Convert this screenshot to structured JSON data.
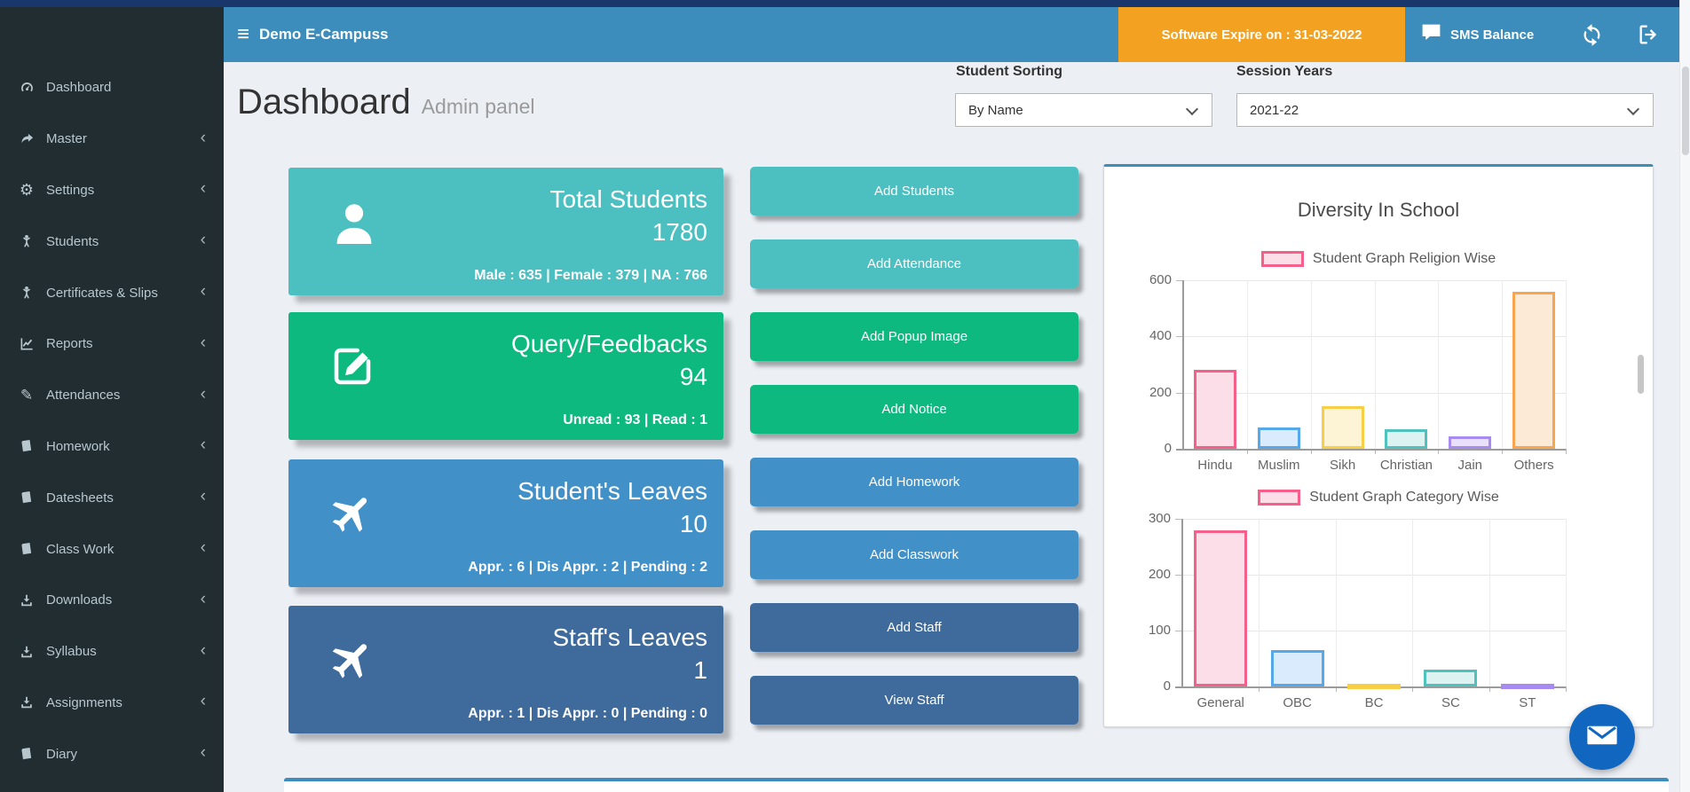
{
  "page": {
    "background": "#ecf0f5",
    "accent": "#3c8dbc"
  },
  "navbar": {
    "color": "#3c8dbc",
    "top_strip_color": "#1a376b",
    "title": "Demo E-Campuss",
    "expire_badge": {
      "text": "Software Expire on : 31-03-2022",
      "color": "#f3a120"
    },
    "sms_balance": {
      "icon": "comment-icon",
      "label": "SMS Balance"
    },
    "refresh_icon": "refresh-icon",
    "logout_icon": "logout-icon"
  },
  "sidebar": {
    "background": "#222d32",
    "text_color": "#b8c7ce",
    "items": [
      {
        "label": "Dashboard",
        "icon": "dashboard-icon",
        "chevron": false
      },
      {
        "label": "Master",
        "icon": "forward-arrow-icon",
        "chevron": true
      },
      {
        "label": "Settings",
        "icon": "gear-icon",
        "chevron": true
      },
      {
        "label": "Students",
        "icon": "child-icon",
        "chevron": true
      },
      {
        "label": "Certificates & Slips",
        "icon": "child-icon",
        "chevron": true
      },
      {
        "label": "Reports",
        "icon": "line-chart-icon",
        "chevron": true
      },
      {
        "label": "Attendances",
        "icon": "pencil-icon",
        "chevron": true
      },
      {
        "label": "Homework",
        "icon": "book-icon",
        "chevron": true
      },
      {
        "label": "Datesheets",
        "icon": "book-icon",
        "chevron": true
      },
      {
        "label": "Class Work",
        "icon": "book-icon",
        "chevron": true
      },
      {
        "label": "Downloads",
        "icon": "download-icon",
        "chevron": true
      },
      {
        "label": "Syllabus",
        "icon": "download-icon",
        "chevron": true
      },
      {
        "label": "Assignments",
        "icon": "download-icon",
        "chevron": true
      },
      {
        "label": "Diary",
        "icon": "book-icon",
        "chevron": true
      }
    ]
  },
  "header": {
    "title": "Dashboard",
    "subtitle": "Admin panel",
    "student_sorting": {
      "label": "Student Sorting",
      "value": "By Name"
    },
    "session_years": {
      "label": "Session Years",
      "value": "2021-22"
    }
  },
  "cards": [
    {
      "title": "Total Students",
      "value": "1780",
      "stats": "Male : 635 | Female : 379 | NA : 766",
      "color": "#4cbfc0",
      "icon": "user-icon"
    },
    {
      "title": "Query/Feedbacks",
      "value": "94",
      "stats": "Unread : 93 | Read : 1",
      "color": "#0db97e",
      "icon": "edit-icon"
    },
    {
      "title": "Student's Leaves",
      "value": "10",
      "stats": "Appr. : 6 | Dis Appr. : 2 | Pending : 2",
      "color": "#4290c8",
      "icon": "plane-icon"
    },
    {
      "title": "Staff's Leaves",
      "value": "1",
      "stats": "Appr. : 1 | Dis Appr. : 0 | Pending : 0",
      "color": "#3e6b9c",
      "icon": "plane-icon"
    }
  ],
  "actions": [
    {
      "label": "Add Students",
      "color": "#4cbfc0"
    },
    {
      "label": "Add Attendance",
      "color": "#4cbfc0"
    },
    {
      "label": "Add Popup Image",
      "color": "#0db97e"
    },
    {
      "label": "Add Notice",
      "color": "#0db97e"
    },
    {
      "label": "Add Homework",
      "color": "#4290c8"
    },
    {
      "label": "Add Classwork",
      "color": "#4290c8"
    },
    {
      "label": "Add Staff",
      "color": "#3e6b9c"
    },
    {
      "label": "View Staff",
      "color": "#3e6b9c"
    }
  ],
  "chart_data": [
    {
      "type": "bar",
      "title": "Diversity In School",
      "legend": "Student Graph Religion Wise",
      "categories": [
        "Hindu",
        "Muslim",
        "Sikh",
        "Christian",
        "Jain",
        "Others"
      ],
      "values": [
        280,
        75,
        150,
        70,
        45,
        560
      ],
      "ylim": [
        0,
        600
      ],
      "yticks": [
        600,
        400,
        200,
        0
      ],
      "grid": true,
      "legend_position": "top",
      "colors": [
        {
          "border": "#f4608a",
          "fill": "#fbdee8"
        },
        {
          "border": "#55a8ea",
          "fill": "#d9ebfc"
        },
        {
          "border": "#f7ce45",
          "fill": "#fdf4d5"
        },
        {
          "border": "#4fc2bd",
          "fill": "#dcf3f1"
        },
        {
          "border": "#a88bf0",
          "fill": "#e9e1fc"
        },
        {
          "border": "#f7a54e",
          "fill": "#fdead6"
        }
      ]
    },
    {
      "type": "bar",
      "legend": "Student Graph Category Wise",
      "categories": [
        "General",
        "OBC",
        "BC",
        "SC",
        "ST"
      ],
      "values": [
        280,
        65,
        5,
        30,
        5
      ],
      "ylim": [
        0,
        300
      ],
      "yticks": [
        300,
        200,
        100,
        0
      ],
      "grid": true,
      "legend_position": "top",
      "colors": [
        {
          "border": "#f4608a",
          "fill": "#fbdee8"
        },
        {
          "border": "#55a8ea",
          "fill": "#d9ebfc"
        },
        {
          "border": "#f7ce45",
          "fill": "#fdf4d5"
        },
        {
          "border": "#4fc2bd",
          "fill": "#dcf3f1"
        },
        {
          "border": "#a88bf0",
          "fill": "#e9e1fc"
        }
      ]
    }
  ],
  "fab": {
    "icon": "email-icon",
    "color": "#1166c0"
  }
}
